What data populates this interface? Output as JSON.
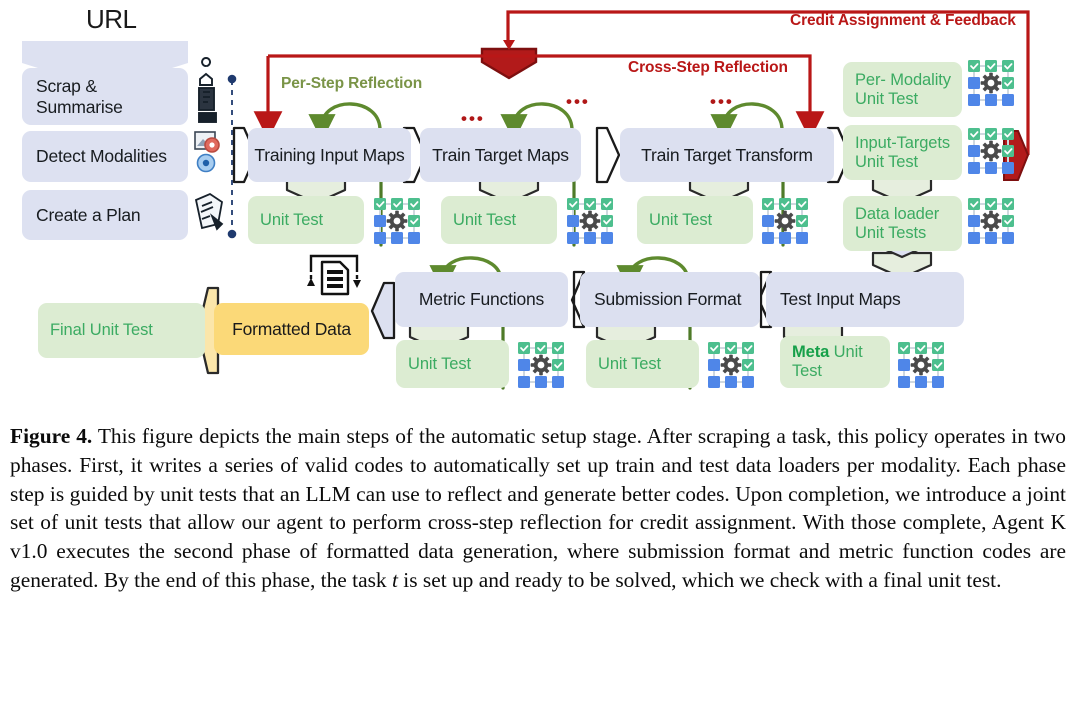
{
  "figure": {
    "url_label": "URL",
    "left_steps": [
      {
        "label": "Scrap & Summarise",
        "icon": "scrape-robot-icon"
      },
      {
        "label": "Detect Modalities",
        "icon": "modality-detect-icon"
      },
      {
        "label": "Create a Plan",
        "icon": "plan-document-icon"
      }
    ],
    "annotations": {
      "credit_assignment": "Credit Assignment & Feedback",
      "cross_step": "Cross-Step Reflection",
      "per_step": "Per-Step Reflection",
      "ellipsis": "•••"
    },
    "top_row_steps": [
      {
        "label": "Training Input Maps"
      },
      {
        "label": "Train Target Maps"
      },
      {
        "label": "Train Target Transform"
      }
    ],
    "top_row_tests": [
      {
        "label": "Unit Test"
      },
      {
        "label": "Unit Test"
      },
      {
        "label": "Unit Test"
      }
    ],
    "right_column_tests": [
      {
        "label": "Per- Modality\nUnit Test",
        "line1": "Per- Modality",
        "line2": "Unit Test"
      },
      {
        "label": "Input-Targets\nUnit Test",
        "line1": "Input-Targets",
        "line2": "Unit Test"
      },
      {
        "label": "Data loader\nUnit Tests",
        "line1": "Data loader",
        "line2": "Unit Tests"
      }
    ],
    "bottom_row_steps": [
      {
        "label": "Test Input Maps"
      },
      {
        "label": "Submission Format"
      },
      {
        "label": "Metric Functions"
      }
    ],
    "bottom_row_tests": [
      {
        "label_bold": "Meta",
        "label_rest": " Unit Test"
      },
      {
        "label": "Unit Test"
      },
      {
        "label": "Unit Test"
      }
    ],
    "formatted_data": "Formatted Data",
    "final_unit_test": "Final Unit Test",
    "colors": {
      "blue_box": "#dce0f0",
      "green_box": "#dcecd2",
      "yellow_box": "#fbd978",
      "green_text": "#3bab62",
      "red_accent": "#b91717",
      "olive_label": "#7a9447",
      "grid_green": "#4dbf8e",
      "grid_blue": "#4f86e8"
    }
  },
  "caption": {
    "label": "Figure 4.",
    "text_part1": " This figure depicts the main steps of the automatic setup stage. After scraping a task, this policy operates in two phases. First, it writes a series of valid codes to automatically set up train and test data loaders per modality. Each phase step is guided by unit tests that an LLM can use to reflect and generate better codes. Upon completion, we introduce a joint set of unit tests that allow our agent to perform cross-step reflection for credit assignment. With those complete, Agent K v1.0 executes the second phase of formatted data generation, where submission format and metric function codes are generated. By the end of this phase, the task ",
    "math_var": "t",
    "text_part2": " is set up and ready to be solved, which we check with a final unit test."
  }
}
